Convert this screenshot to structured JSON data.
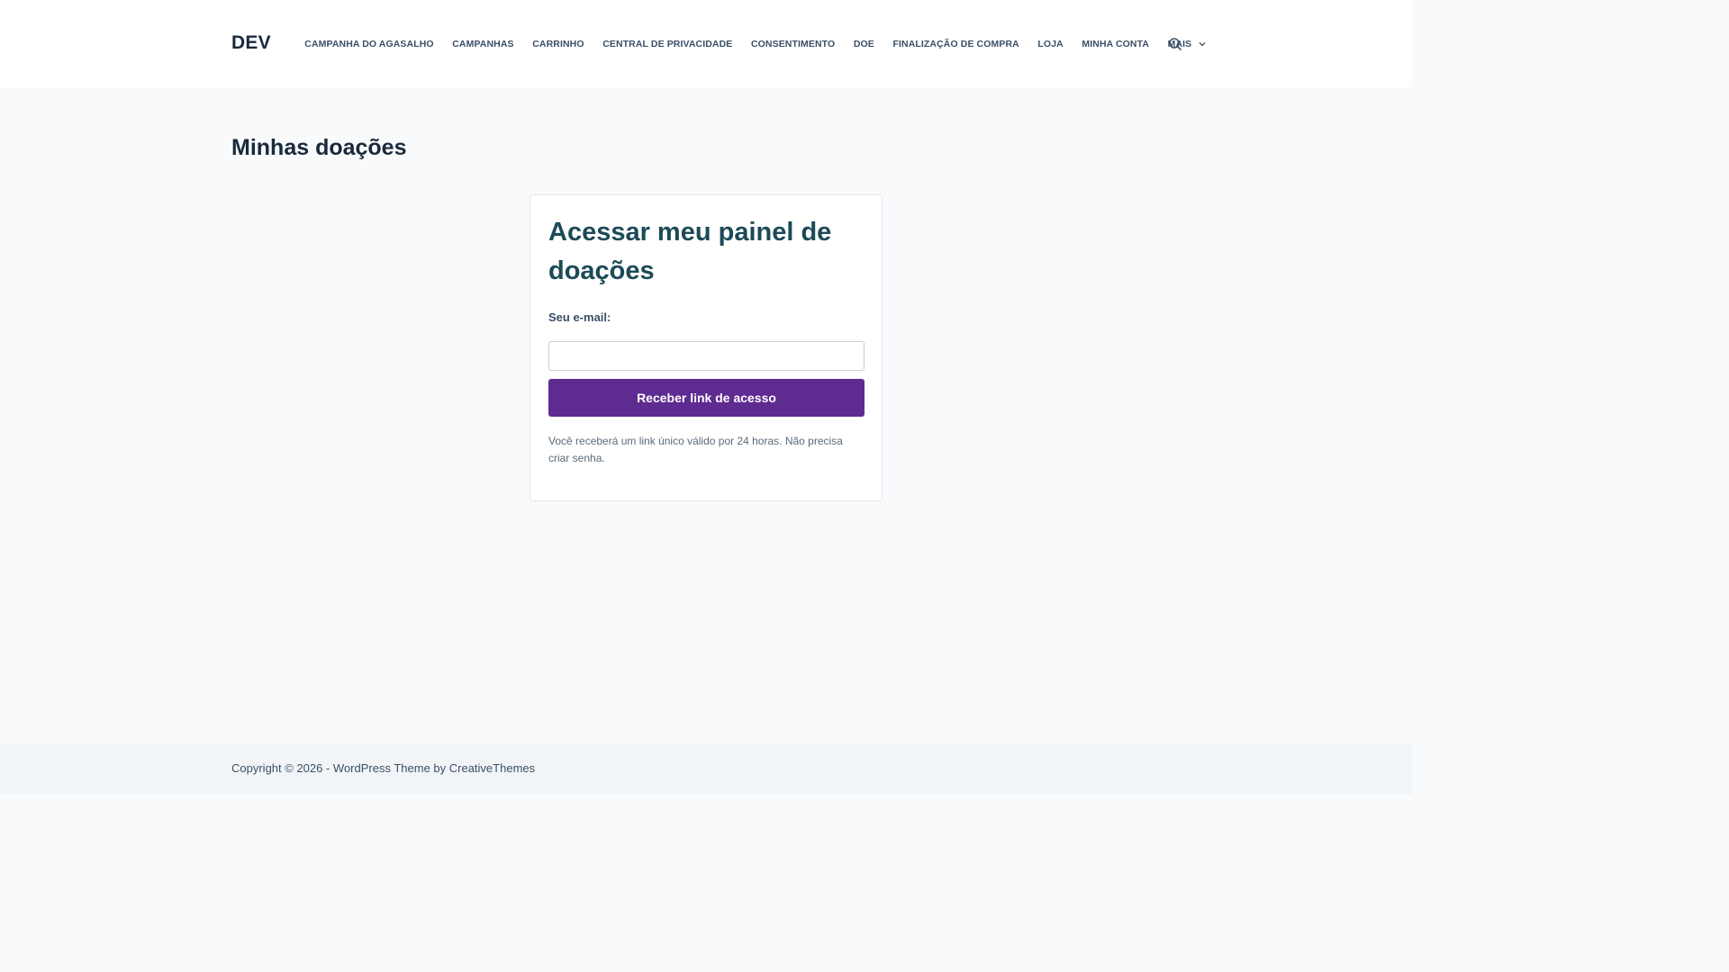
{
  "header": {
    "brand": "DEV",
    "nav": [
      "CAMPANHA DO AGASALHO",
      "CAMPANHAS",
      "CARRINHO",
      "CENTRAL DE PRIVACIDADE",
      "CONSENTIMENTO",
      "DOE",
      "FINALIZAÇÃO DE COMPRA",
      "LOJA",
      "MINHA CONTA"
    ],
    "more_label": "MAIS",
    "icons": {
      "search": "search-icon",
      "more": "chevron-down-icon"
    }
  },
  "page": {
    "title": "Minhas doações"
  },
  "card": {
    "title": "Acessar meu painel de doações",
    "email_label": "Seu e-mail:",
    "email_value": "",
    "button_label": "Receber link de acesso",
    "helper": "Você receberá um link único válido por 24 horas. Não precisa criar senha."
  },
  "footer": {
    "copyright": "Copyright © 2026 - WordPress Theme by CreativeThemes"
  },
  "colors": {
    "primary_button": "#5e2b91",
    "card_title": "#1c4a57",
    "heading": "#192a3d",
    "page_bg": "#f9fafb",
    "footer_bg": "#f2f5f7"
  }
}
